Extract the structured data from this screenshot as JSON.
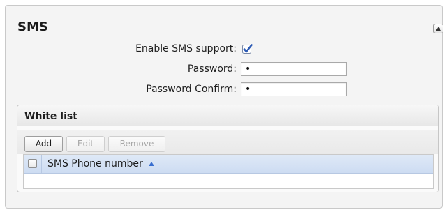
{
  "panel": {
    "title": "SMS",
    "collapse_icon": "chevron-up-icon"
  },
  "form": {
    "enable_label": "Enable SMS support:",
    "enable_checked": true,
    "password_label": "Password:",
    "password_value": "•",
    "confirm_label": "Password Confirm:",
    "confirm_value": "•"
  },
  "whitelist": {
    "title": "White list",
    "toolbar": {
      "add_label": "Add",
      "edit_label": "Edit",
      "remove_label": "Remove"
    },
    "grid": {
      "columns": [
        "SMS Phone number"
      ],
      "sort_icon": "sort-ascending-icon",
      "rows": []
    }
  },
  "colors": {
    "checkbox_accent": "#3a63b8",
    "grid_header": "#d6e2f4"
  }
}
